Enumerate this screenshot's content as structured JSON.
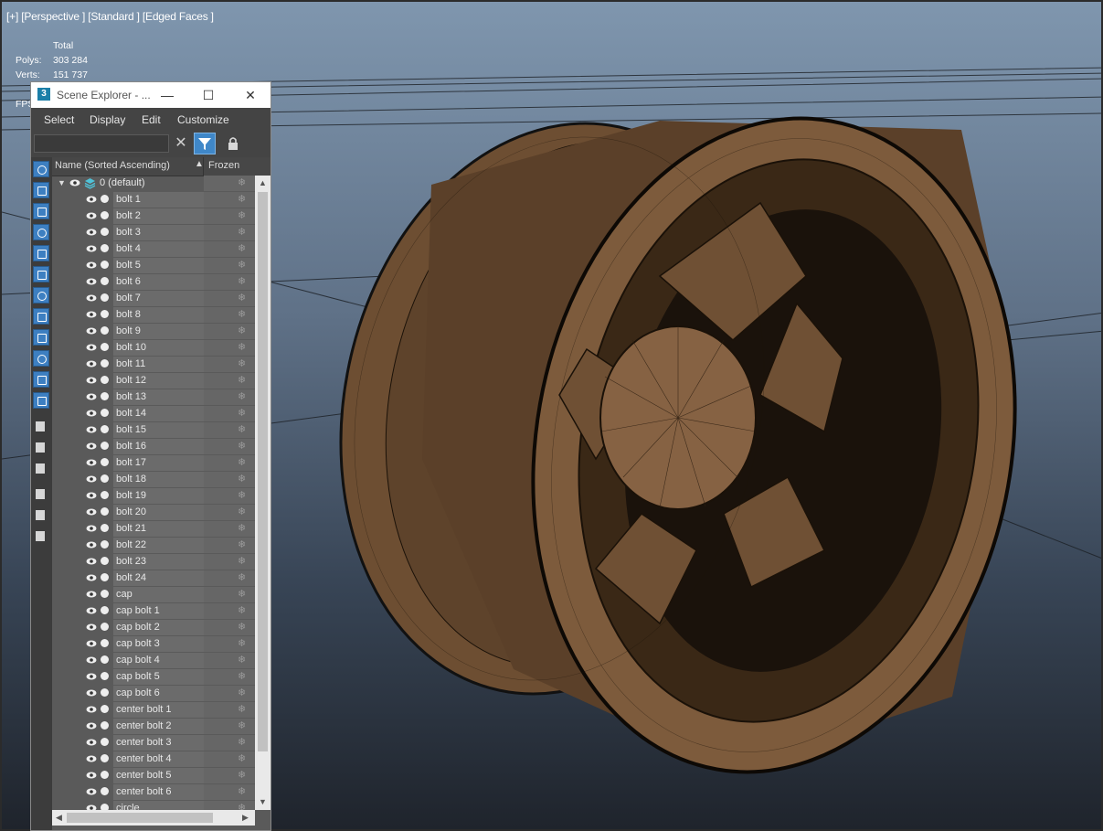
{
  "viewport": {
    "label": "[+] [Perspective ] [Standard ] [Edged Faces ]",
    "stats": {
      "header": "Total",
      "polys_label": "Polys:",
      "polys_value": "303 284",
      "verts_label": "Verts:",
      "verts_value": "151 737",
      "fps_label": "FPS"
    }
  },
  "explorer": {
    "app_logo": "3",
    "title": "Scene Explorer - ...",
    "window_controls": {
      "minimize": "—",
      "maximize": "☐",
      "close": "✕"
    },
    "menus": [
      "Select",
      "Display",
      "Edit",
      "Customize"
    ],
    "search": {
      "value": "",
      "placeholder": ""
    },
    "clear_symbol": "✕",
    "columns": {
      "name": "Name (Sorted Ascending)",
      "sort_indicator": "▲",
      "frozen": "Frozen"
    },
    "layer": {
      "name": "0 (default)"
    },
    "objects": [
      "bolt 1",
      "bolt 2",
      "bolt 3",
      "bolt 4",
      "bolt 5",
      "bolt 6",
      "bolt 7",
      "bolt 8",
      "bolt 9",
      "bolt 10",
      "bolt 11",
      "bolt 12",
      "bolt 13",
      "bolt 14",
      "bolt 15",
      "bolt 16",
      "bolt 17",
      "bolt 18",
      "bolt 19",
      "bolt 20",
      "bolt 21",
      "bolt 22",
      "bolt 23",
      "bolt 24",
      "cap",
      "cap bolt 1",
      "cap bolt 2",
      "cap bolt 3",
      "cap bolt 4",
      "cap bolt 5",
      "cap bolt 6",
      "center bolt 1",
      "center bolt 2",
      "center bolt 3",
      "center bolt 4",
      "center bolt 5",
      "center bolt 6",
      "circle"
    ],
    "frozen_symbol": "❄",
    "side_tools": [
      "geometry-filter-icon",
      "shapes-filter-icon",
      "lights-filter-icon",
      "cameras-filter-icon",
      "helpers-filter-icon",
      "spacewarps-filter-icon",
      "groups-filter-icon",
      "xrefs-filter-icon",
      "bones-filter-icon",
      "containers-filter-icon",
      "frozen-filter-icon",
      "hidden-filter-icon",
      "display-all-icon",
      "display-none-icon",
      "invert-display-icon",
      "filter-settings-icon",
      "filter-icon",
      "selection-set-icon"
    ]
  },
  "colors": {
    "accent": "#3d7fc1",
    "mesh": "#7a5a3c"
  }
}
